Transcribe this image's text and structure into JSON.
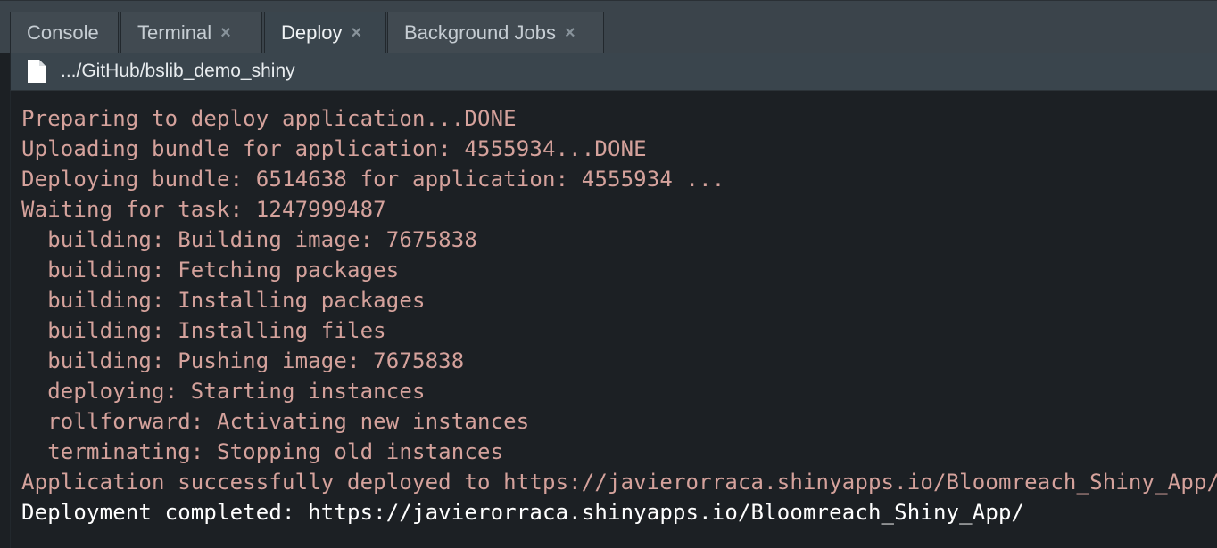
{
  "tabs": [
    {
      "label": "Console",
      "closable": false,
      "active": false
    },
    {
      "label": "Terminal",
      "closable": true,
      "active": false
    },
    {
      "label": "Deploy",
      "closable": true,
      "active": true
    },
    {
      "label": "Background Jobs",
      "closable": true,
      "active": false
    }
  ],
  "close_glyph": "×",
  "path": {
    "icon": "file-icon",
    "text": ".../GitHub/bslib_demo_shiny"
  },
  "output": [
    "Preparing to deploy application...DONE",
    "Uploading bundle for application: 4555934...DONE",
    "Deploying bundle: 6514638 for application: 4555934 ...",
    "Waiting for task: 1247999487",
    "  building: Building image: 7675838",
    "  building: Fetching packages",
    "  building: Installing packages",
    "  building: Installing files",
    "  building: Pushing image: 7675838",
    "  deploying: Starting instances",
    "  rollforward: Activating new instances",
    "  terminating: Stopping old instances",
    "Application successfully deployed to https://javierorraca.shinyapps.io/Bloomreach_Shiny_App/",
    "Deployment completed: https://javierorraca.shinyapps.io/Bloomreach_Shiny_App/"
  ],
  "colors": {
    "message": "#d5a29c",
    "result": "#ffffff",
    "background": "#1c2024",
    "tabbar": "#3b444b"
  }
}
